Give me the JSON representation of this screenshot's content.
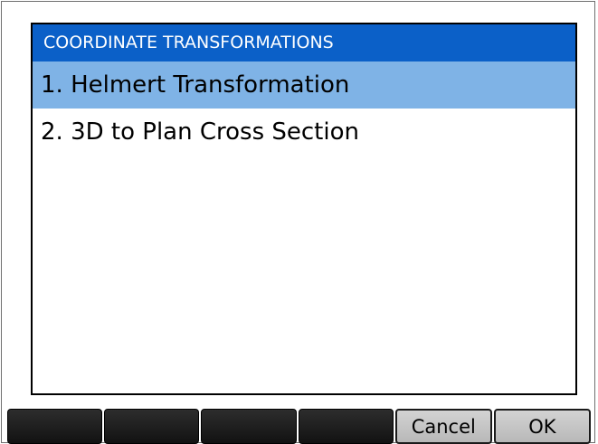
{
  "dialog": {
    "title": "COORDINATE TRANSFORMATIONS",
    "items": [
      {
        "label": "1. Helmert Transformation",
        "selected": true
      },
      {
        "label": "2. 3D to Plan Cross Section",
        "selected": false
      }
    ]
  },
  "softkeys": [
    "",
    "",
    "",
    "",
    "Cancel",
    "OK"
  ],
  "colors": {
    "title_bar": "#0b60c8",
    "selection": "#7fb3e6",
    "softkey_blank": "#1e1e1e",
    "softkey_labeled": "#c9c9c9"
  }
}
